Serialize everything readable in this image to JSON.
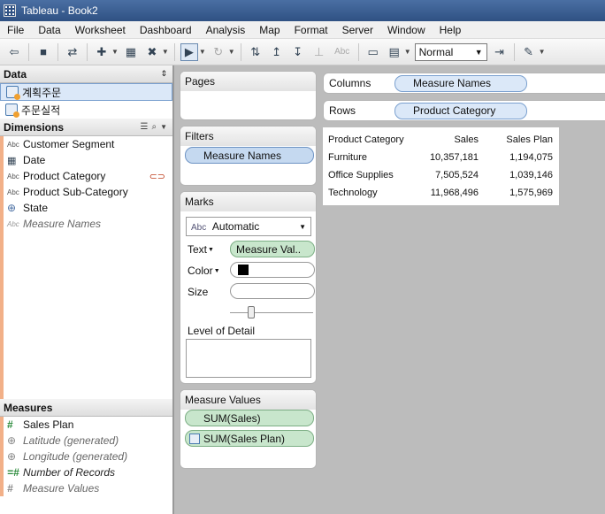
{
  "window": {
    "title": "Tableau - Book2"
  },
  "menu": [
    "File",
    "Data",
    "Worksheet",
    "Dashboard",
    "Analysis",
    "Map",
    "Format",
    "Server",
    "Window",
    "Help"
  ],
  "toolbar": {
    "fit_value": "Normal",
    "abc_label": "Abc"
  },
  "data_pane": {
    "header": "Data",
    "datasources": [
      {
        "label": "계획주문",
        "selected": true
      },
      {
        "label": "주문실적",
        "selected": false
      }
    ],
    "dimensions_header": "Dimensions",
    "dimensions": [
      {
        "type": "Abc",
        "label": "Customer Segment"
      },
      {
        "type": "date",
        "label": "Date"
      },
      {
        "type": "Abc",
        "label": "Product Category",
        "linked": true
      },
      {
        "type": "Abc",
        "label": "Product Sub-Category"
      },
      {
        "type": "globe",
        "label": "State"
      },
      {
        "type": "Abc",
        "label": "Measure Names",
        "italic": true
      }
    ],
    "measures_header": "Measures",
    "measures": [
      {
        "type": "#",
        "label": "Sales Plan"
      },
      {
        "type": "globe",
        "label": "Latitude (generated)",
        "italic": true
      },
      {
        "type": "globe",
        "label": "Longitude (generated)",
        "italic": true
      },
      {
        "type": "=#",
        "label": "Number of Records",
        "italic": true
      },
      {
        "type": "#",
        "label": "Measure Values",
        "italic": true
      }
    ]
  },
  "shelves": {
    "pages_label": "Pages",
    "filters_label": "Filters",
    "filter_pill": "Measure Names",
    "marks_label": "Marks",
    "marks_type_icon": "Abc",
    "marks_type": "Automatic",
    "text_label": "Text",
    "text_pill": "Measure Val..",
    "color_label": "Color",
    "size_label": "Size",
    "detail_label": "Level of Detail",
    "measure_values_label": "Measure Values",
    "measure_values": [
      "SUM(Sales)",
      "SUM(Sales Plan)"
    ],
    "columns_label": "Columns",
    "columns_pill": "Measure Names",
    "rows_label": "Rows",
    "rows_pill": "Product Category"
  },
  "table": {
    "headers": [
      "Product Category",
      "Sales",
      "Sales Plan"
    ],
    "rows": [
      [
        "Furniture",
        "10,357,181",
        "1,194,075"
      ],
      [
        "Office Supplies",
        "7,505,524",
        "1,039,146"
      ],
      [
        "Technology",
        "11,968,496",
        "1,575,969"
      ]
    ]
  },
  "colors": {
    "dimension_bar": "#f2b088",
    "measure_pill": "#c8e6cc",
    "dimension_pill": "#c5d9f0"
  }
}
